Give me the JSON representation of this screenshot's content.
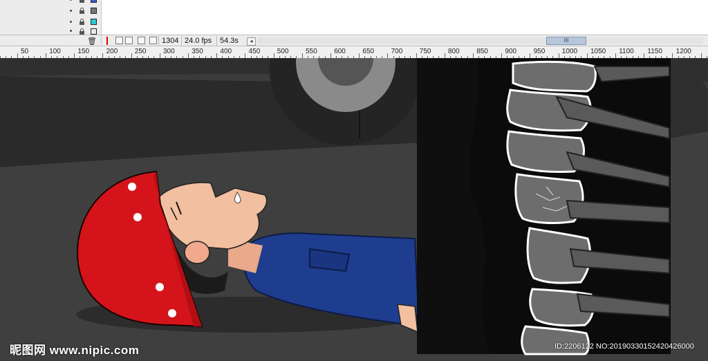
{
  "timeline": {
    "layers": [
      {
        "swatch_color": "#3b5fc7"
      },
      {
        "swatch_color": "#777777"
      },
      {
        "swatch_color": "#2ec9d6"
      },
      {
        "swatch_color": "#d23fd6"
      }
    ]
  },
  "status_bar": {
    "frame": "1304",
    "fps": "24.0 fps",
    "time": "54.3s",
    "scroll_left_glyph": "◂",
    "scroll_thumb_glyph": "III"
  },
  "ruler": {
    "labels": [
      "50",
      "100",
      "150",
      "200",
      "250",
      "300",
      "350",
      "400",
      "450",
      "500",
      "550",
      "600",
      "650",
      "700",
      "750",
      "800",
      "850",
      "900",
      "950",
      "1000",
      "1050",
      "1100",
      "1150",
      "1200"
    ]
  },
  "watermark": {
    "site": "昵图网 www.nipic.com",
    "id_text": "ID:2206122 NO:20190330152420426000"
  },
  "colors": {
    "stage_bg": "#3a3a3a",
    "helmet": "#d4141a",
    "shirt": "#1f3d8f",
    "skin": "#f2bfa0",
    "xray_bg": "#0b0b0b"
  }
}
